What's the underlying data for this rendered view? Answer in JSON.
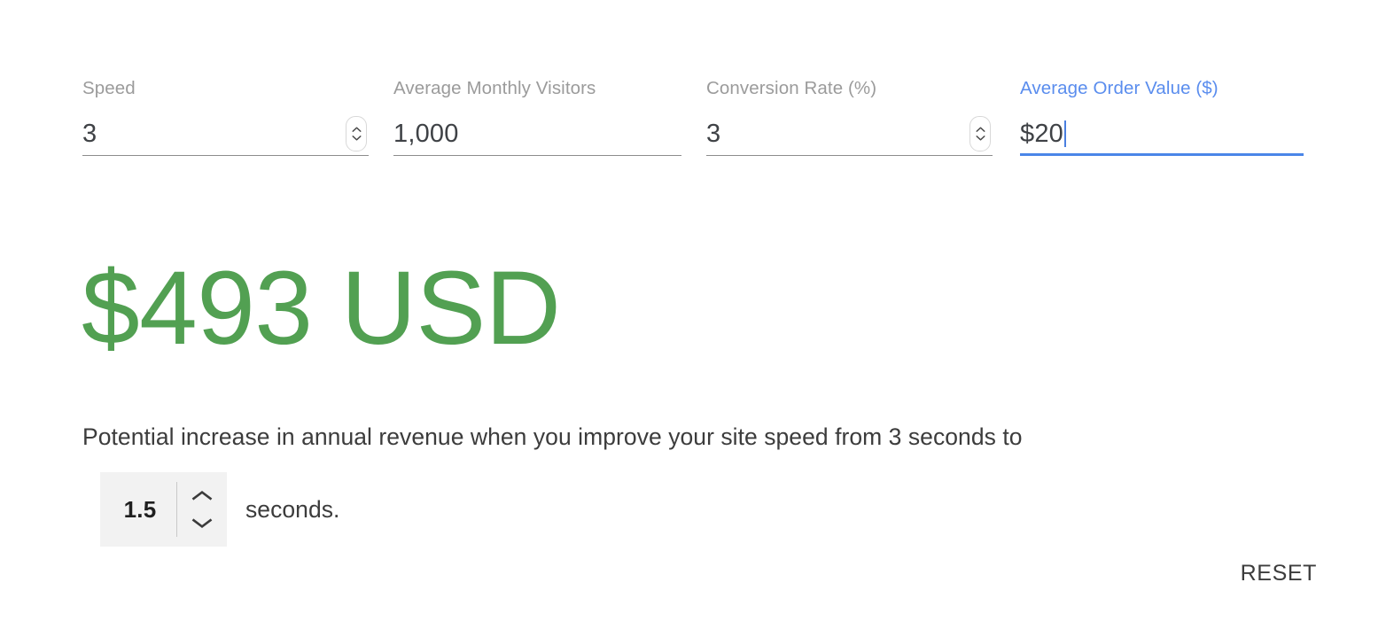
{
  "calculator": {
    "fields": [
      {
        "id": "speed",
        "label": "Speed",
        "value": "3",
        "focused": false,
        "has_spinner": true,
        "spinner_up_icon": "chevron-up-icon",
        "spinner_down_icon": "chevron-down-icon"
      },
      {
        "id": "average-monthly-visitors",
        "label": "Average Monthly Visitors",
        "value": "1,000",
        "focused": false,
        "has_spinner": false
      },
      {
        "id": "conversion-rate",
        "label": "Conversion Rate (%)",
        "value": "3",
        "focused": false,
        "has_spinner": true,
        "spinner_up_icon": "chevron-up-icon",
        "spinner_down_icon": "chevron-down-icon"
      },
      {
        "id": "average-order-value",
        "label": "Average Order Value ($)",
        "value": "$20",
        "focused": true,
        "has_spinner": false
      }
    ],
    "result": {
      "amount": "$493 USD",
      "description": "Potential increase in annual revenue when you improve your site speed from 3 seconds to",
      "seconds_value": "1.5",
      "seconds_label": "seconds.",
      "stepper_up_icon": "chevron-up-icon",
      "stepper_down_icon": "chevron-down-icon"
    },
    "reset_label": "RESET",
    "colors": {
      "result_green": "#52a052",
      "focus_blue": "#4a86e8",
      "focus_label_blue": "#5a8dee",
      "label_gray": "#9b9b9b",
      "value_gray": "#3f4246",
      "text_dark": "#3c3c3c",
      "underline_gray": "#8d8d8d",
      "stepper_bg": "#f2f2f2",
      "page_bg": "#ffffff"
    }
  }
}
